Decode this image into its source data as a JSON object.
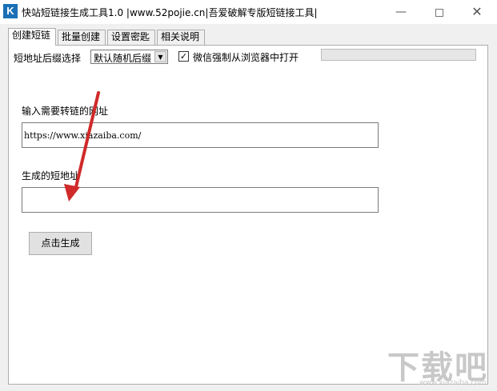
{
  "window": {
    "icon_glyph": "K",
    "title": "快站短链接生成工具1.0 |www.52pojie.cn|吾爱破解专版短链接工具|",
    "minimize_glyph": "—",
    "close_glyph": "✕"
  },
  "tabs": [
    {
      "label": "创建短链",
      "active": true
    },
    {
      "label": "批量创建",
      "active": false
    },
    {
      "label": "设置密匙",
      "active": false
    },
    {
      "label": "相关说明",
      "active": false
    }
  ],
  "form": {
    "suffix_label": "短地址后缀选择",
    "suffix_selected": "默认随机后缀",
    "checkbox_label": "微信强制从浏览器中打开",
    "checkbox_checked": true,
    "checkbox_glyph": "✓",
    "dropdown_glyph": "▼",
    "progress_fraction": 0,
    "url_label": "输入需要转链的网址",
    "url_value": "https://www.xiazaiba.com/",
    "short_label": "生成的短地址",
    "short_value": "",
    "generate_button": "点击生成"
  },
  "annotation": {
    "arrow_color": "#d02a2a"
  },
  "watermark": {
    "text": "下载吧",
    "sub": "www.xiazaiba.com"
  }
}
